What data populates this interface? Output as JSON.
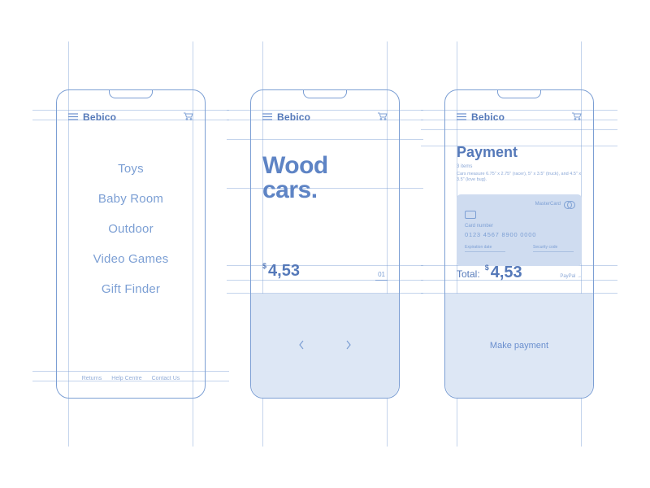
{
  "brand": "Bebico",
  "screen1": {
    "menu": [
      "Toys",
      "Baby Room",
      "Outdoor",
      "Video Games",
      "Gift Finder"
    ],
    "footer": [
      "Returns",
      "Help Centre",
      "Contact Us"
    ]
  },
  "screen2": {
    "headline_line1": "Wood",
    "headline_line2": "cars.",
    "currency": "$",
    "price": "4,53",
    "page_indicator": "01"
  },
  "screen3": {
    "title": "Payment",
    "items_count": "3 items",
    "description": "Cars measure 6.75\" x 2.75\" (racer), 5\" x 3.5\" (truck), and 4.5\" x 3.5\" (love bug).",
    "card": {
      "brand": "MasterCard",
      "number_label": "Card number",
      "number_placeholder": "0123 4567 8900 0000",
      "exp_label": "Expiration date",
      "cvv_label": "Security code"
    },
    "total_label": "Total:",
    "total_currency": "$",
    "total_value": "4,53",
    "paypal": "PayPal →",
    "cta": "Make payment"
  }
}
